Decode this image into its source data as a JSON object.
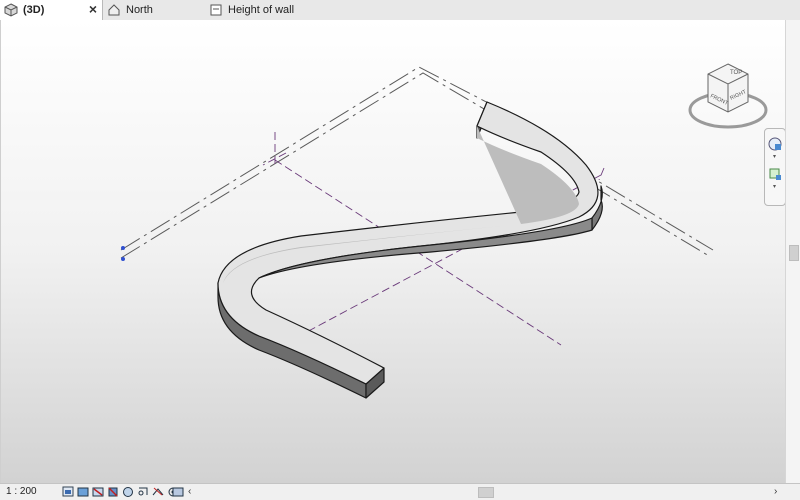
{
  "tabs": [
    {
      "label": "(3D)",
      "icon": "3d-view-icon",
      "active": true
    },
    {
      "label": "North",
      "icon": "elevation-view-icon",
      "active": false
    },
    {
      "label": "Height of wall",
      "icon": "section-view-icon",
      "active": false
    }
  ],
  "viewcube": {
    "top": "TOP",
    "front": "FRONT",
    "right": "RIGHT"
  },
  "status": {
    "scale": "1 : 200"
  },
  "colors": {
    "wall_face": "#e4e4e4",
    "wall_dark": "#6d6d6d",
    "level_line": "#4a4a4a",
    "grid_line": "#6a3a7a"
  }
}
